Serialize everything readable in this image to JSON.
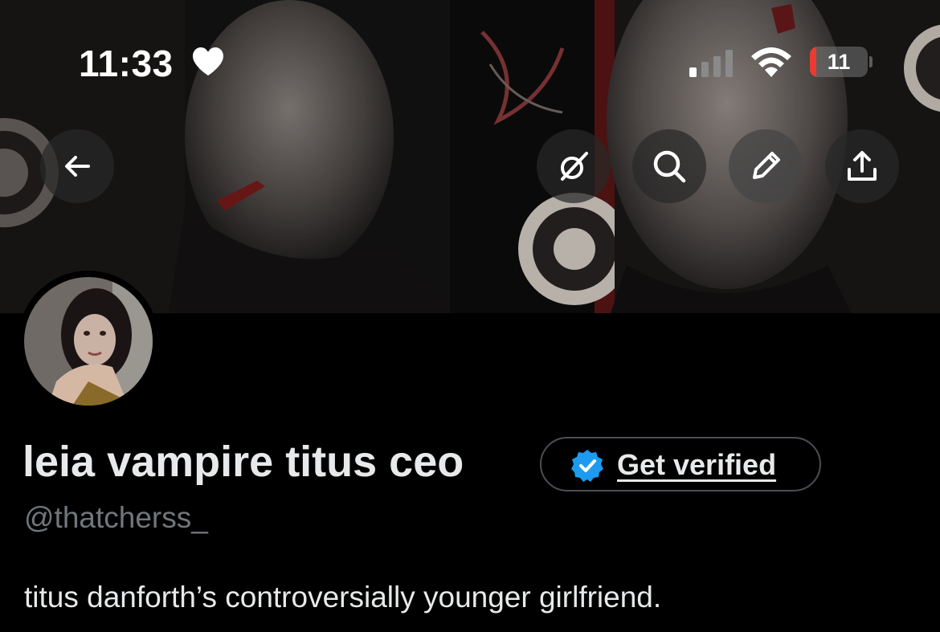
{
  "status_bar": {
    "time": "11:33",
    "battery_level": "11",
    "battery_fraction": 0.11,
    "heart_icon": "heart-icon",
    "signal_icon": "cellular-signal-icon",
    "wifi_icon": "wifi-icon"
  },
  "header_actions": {
    "back_icon": "arrow-left-icon",
    "grok_icon": "grok-icon",
    "search_icon": "search-icon",
    "edit_icon": "pencil-icon",
    "share_icon": "share-icon"
  },
  "profile": {
    "display_name": "leia vampire titus ceo",
    "verify_label": "Get verified",
    "handle": "@thatcherss_",
    "bio": "titus danforth’s controversially younger girlfriend."
  },
  "colors": {
    "background": "#000000",
    "primary_text": "#e7e9ea",
    "secondary_text": "#71767b",
    "verified_blue": "#1d9bf0",
    "battery_low": "#eb3a31",
    "pill_border": "#4a4f54"
  }
}
